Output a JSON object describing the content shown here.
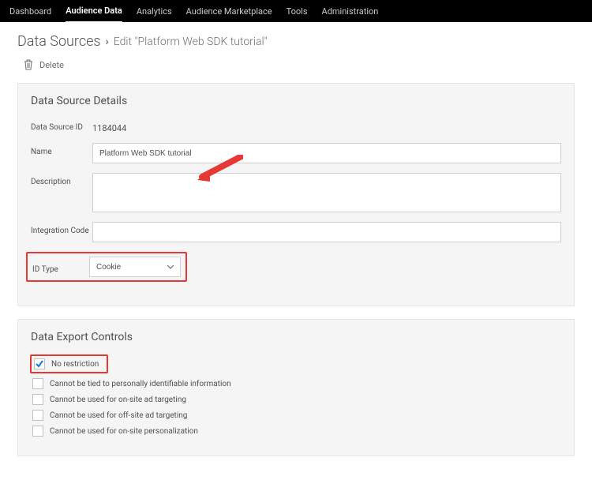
{
  "topnav": {
    "items": [
      {
        "label": "Dashboard"
      },
      {
        "label": "Audience Data"
      },
      {
        "label": "Analytics"
      },
      {
        "label": "Audience Marketplace"
      },
      {
        "label": "Tools"
      },
      {
        "label": "Administration"
      }
    ],
    "active_index": 1
  },
  "breadcrumb": {
    "root": "Data Sources",
    "leaf": "Edit \"Platform Web SDK tutorial\""
  },
  "actions": {
    "delete": "Delete"
  },
  "details": {
    "title": "Data Source Details",
    "labels": {
      "id": "Data Source ID",
      "name": "Name",
      "description": "Description",
      "integration_code": "Integration Code",
      "id_type": "ID Type"
    },
    "values": {
      "id": "1184044",
      "name": "Platform Web SDK tutorial",
      "description": "",
      "integration_code": "",
      "id_type": "Cookie"
    }
  },
  "export_controls": {
    "title": "Data Export Controls",
    "options": [
      {
        "label": "No restriction",
        "checked": true
      },
      {
        "label": "Cannot be tied to personally identifiable information",
        "checked": false
      },
      {
        "label": "Cannot be used for on-site ad targeting",
        "checked": false
      },
      {
        "label": "Cannot be used for off-site ad targeting",
        "checked": false
      },
      {
        "label": "Cannot be used for on-site personalization",
        "checked": false
      }
    ]
  },
  "annotations": {
    "arrow_color": "#e53935",
    "highlight_color": "#e53935"
  }
}
